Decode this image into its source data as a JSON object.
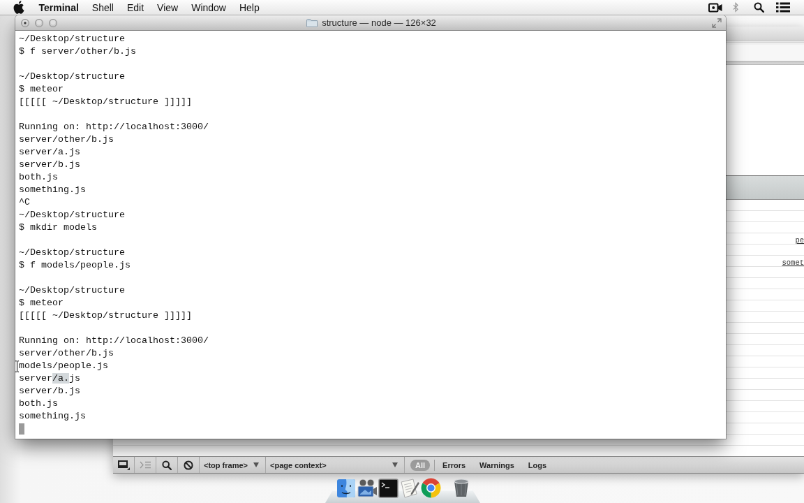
{
  "menu_bar": {
    "app_name": "Terminal",
    "items": [
      "Shell",
      "Edit",
      "View",
      "Window",
      "Help"
    ]
  },
  "terminal_window": {
    "title": "structure — node — 126×32",
    "blocks": [
      {
        "lines": [
          {
            "text": "~/Desktop/structure"
          },
          {
            "text": "$ f server/other/b.js"
          }
        ]
      },
      {
        "lines": [
          {
            "text": "~/Desktop/structure"
          },
          {
            "text": "$ meteor"
          },
          {
            "text": "[[[[[ ~/Desktop/structure ]]]]]"
          }
        ]
      },
      {
        "lines": [
          {
            "text": "Running on: http://localhost:3000/"
          },
          {
            "text": "server/other/b.js"
          },
          {
            "text": "server/a.js"
          },
          {
            "text": "server/b.js"
          },
          {
            "text": "both.js"
          },
          {
            "text": "something.js"
          },
          {
            "text": "^C"
          },
          {
            "text": "~/Desktop/structure"
          },
          {
            "text": "$ mkdir models"
          }
        ]
      },
      {
        "lines": [
          {
            "text": "~/Desktop/structure"
          },
          {
            "text": "$ f models/people.js"
          }
        ]
      },
      {
        "lines": [
          {
            "text": "~/Desktop/structure"
          },
          {
            "text": "$ meteor"
          },
          {
            "text": "[[[[[ ~/Desktop/structure ]]]]]"
          }
        ]
      },
      {
        "lines": [
          {
            "text": "Running on: http://localhost:3000/"
          },
          {
            "text": "server/other/b.js"
          },
          {
            "text": "models/people.js"
          },
          {
            "segments": [
              {
                "text": "server",
                "selected": false
              },
              {
                "text": "/a.",
                "selected": true
              },
              {
                "text": "js",
                "selected": false
              }
            ]
          },
          {
            "text": "server/b.js"
          },
          {
            "text": "both.js"
          },
          {
            "text": "something.js"
          }
        ]
      }
    ],
    "cursor_visible": true
  },
  "background_window": {
    "console_links": [
      "pe",
      "somet"
    ],
    "console_toolbar": {
      "frame_select": "<top frame>",
      "context_select": "<page context>",
      "filters": [
        {
          "label": "All",
          "selected": true
        },
        {
          "label": "Errors",
          "selected": false
        },
        {
          "label": "Warnings",
          "selected": false
        },
        {
          "label": "Logs",
          "selected": false
        }
      ]
    }
  }
}
